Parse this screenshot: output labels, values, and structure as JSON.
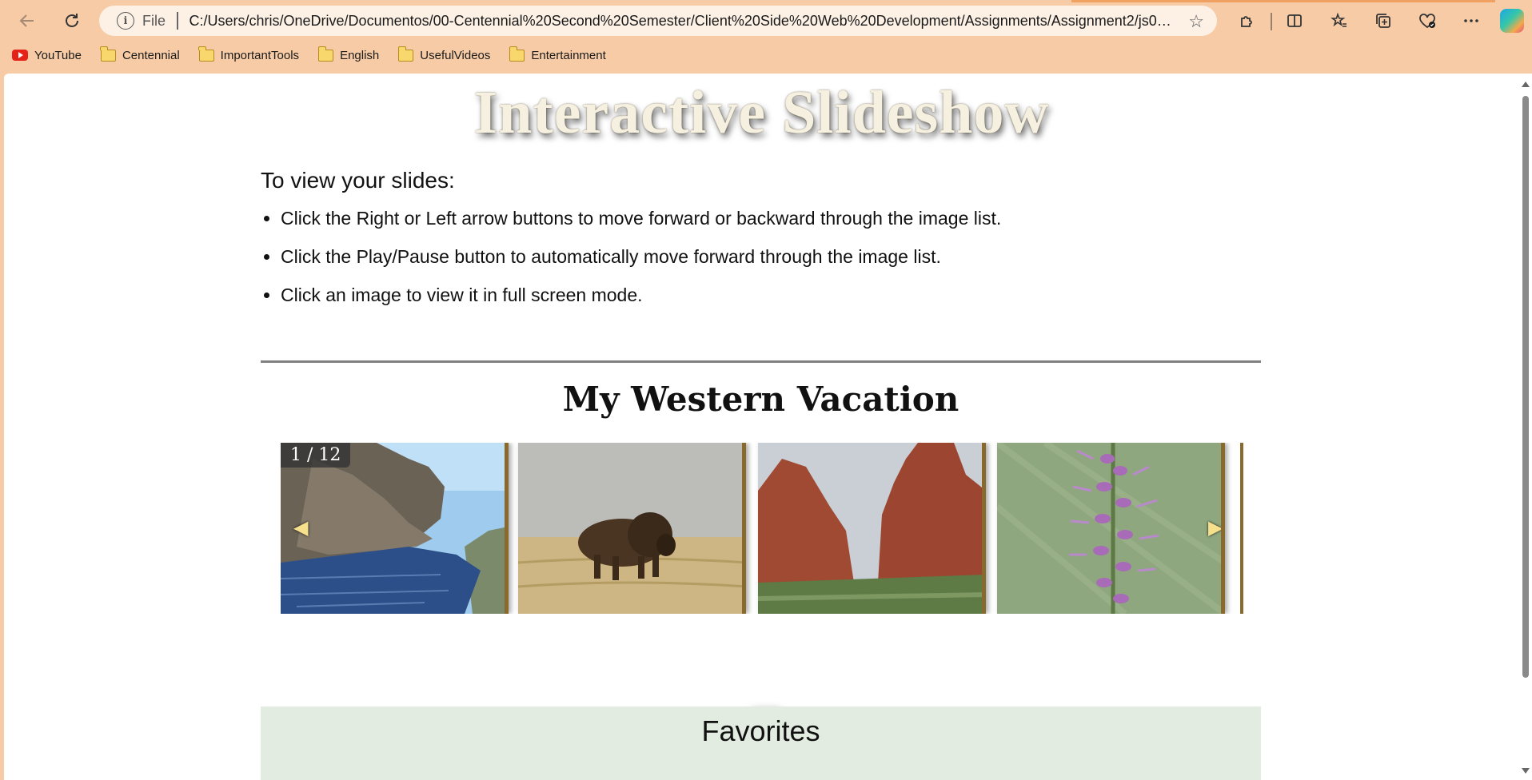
{
  "browser": {
    "address": {
      "scheme_label": "File",
      "url": "C:/Users/chris/OneDrive/Documentos/00-Centennial%20Second%20Semester/Client%20Side%20Web%20Development/Assignments/Assignment2/js05_txt...."
    },
    "bookmarks": [
      {
        "label": "YouTube",
        "icon": "youtube-icon"
      },
      {
        "label": "Centennial",
        "icon": "folder-icon"
      },
      {
        "label": "ImportantTools",
        "icon": "folder-icon"
      },
      {
        "label": "English",
        "icon": "folder-icon"
      },
      {
        "label": "UsefulVideos",
        "icon": "folder-icon"
      },
      {
        "label": "Entertainment",
        "icon": "folder-icon"
      }
    ]
  },
  "page": {
    "title": "Interactive Slideshow",
    "instructions_heading": "To view your slides:",
    "instructions": [
      "Click the Right or Left arrow buttons to move forward or backward through the image list.",
      "Click the Play/Pause button to automatically move forward through the image list.",
      "Click an image to view it in full screen mode."
    ],
    "slideshow_title": "My Western Vacation",
    "counter": "1 / 12",
    "slides": [
      {
        "subject": "mountain lake"
      },
      {
        "subject": "bison on prairie"
      },
      {
        "subject": "red rock formations"
      },
      {
        "subject": "purple wildflower"
      }
    ],
    "favorites_heading": "Favorites"
  }
}
